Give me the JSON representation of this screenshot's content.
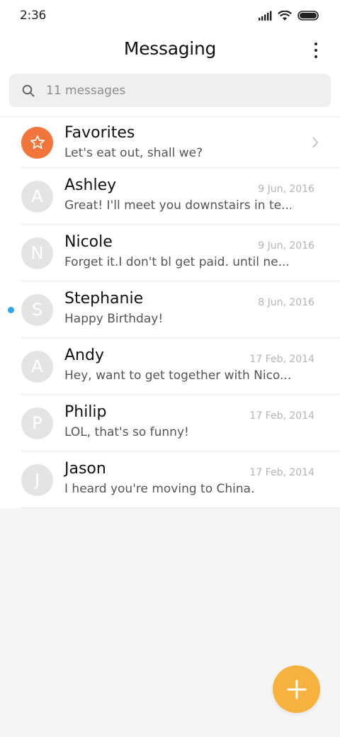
{
  "status_bar": {
    "time": "2:36"
  },
  "header": {
    "title": "Messaging"
  },
  "search": {
    "placeholder": "11 messages"
  },
  "favorites": {
    "name": "Favorites",
    "preview": "Let's eat out, shall we?"
  },
  "conversations": [
    {
      "initial": "A",
      "name": "Ashley",
      "date": "9 Jun, 2016",
      "preview": "Great! I'll meet you downstairs in te...",
      "unread": false
    },
    {
      "initial": "N",
      "name": "Nicole",
      "date": "9 Jun, 2016",
      "preview": "Forget it.I don't bl get paid. until ne...",
      "unread": false
    },
    {
      "initial": "S",
      "name": "Stephanie",
      "date": "8 Jun, 2016",
      "preview": "Happy Birthday!",
      "unread": true
    },
    {
      "initial": "A",
      "name": "Andy",
      "date": "17 Feb, 2014",
      "preview": "Hey, want to get together with Nico...",
      "unread": false
    },
    {
      "initial": "P",
      "name": "Philip",
      "date": "17 Feb, 2014",
      "preview": "LOL, that's so funny!",
      "unread": false
    },
    {
      "initial": "J",
      "name": "Jason",
      "date": "17 Feb, 2014",
      "preview": "I heard you're moving to China.",
      "unread": false
    }
  ],
  "colors": {
    "favorites_avatar": "#f2763c",
    "fab": "#f6b23c",
    "unread_dot": "#2aa5f0",
    "avatar_gray": "#e4e4e4"
  },
  "icons": [
    "cellular-signal-icon",
    "wifi-icon",
    "battery-icon",
    "more-vertical-icon",
    "search-icon",
    "star-icon",
    "chevron-right-icon",
    "plus-icon"
  ]
}
